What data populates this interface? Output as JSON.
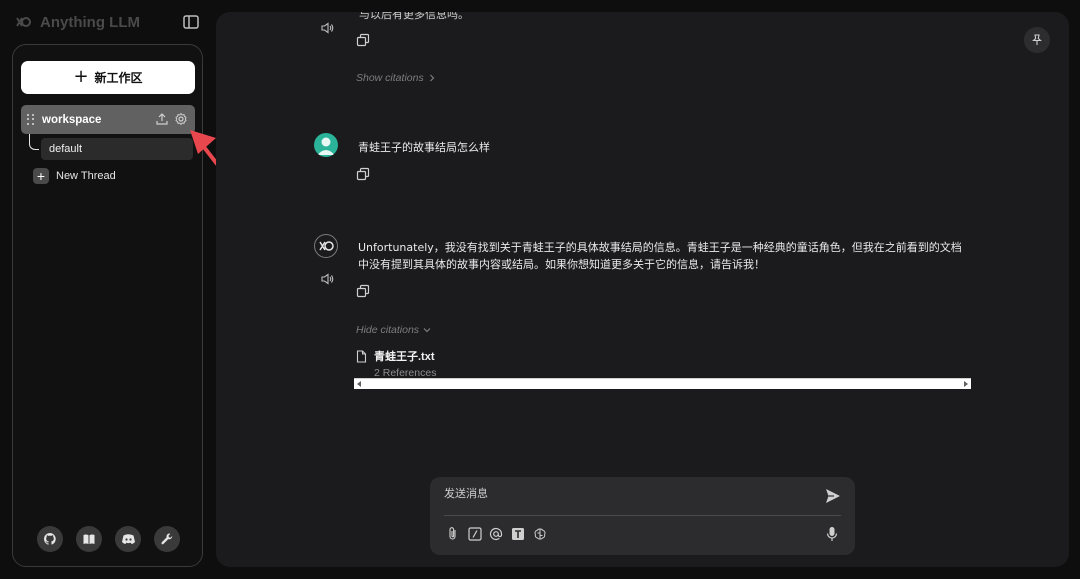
{
  "app": {
    "brand_name": "Anything LLM"
  },
  "sidebar": {
    "new_workspace_label": "新工作区",
    "workspace_name": "workspace",
    "thread_default": "default",
    "new_thread_label": "New Thread",
    "footer_icons": [
      "github-icon",
      "docs-book-icon",
      "discord-icon",
      "settings-wrench-icon"
    ]
  },
  "chat": {
    "top_partial_text": "与以后有更多信息吗。",
    "show_citations_label": "Show citations",
    "user_message": "青蛙王子的故事结局怎么样",
    "assistant_message": "Unfortunately，我没有找到关于青蛙王子的具体故事结局的信息。青蛙王子是一种经典的童话角色，但我在之前看到的文档中没有提到其具体的故事内容或结局。如果你想知道更多关于它的信息，请告诉我！",
    "hide_citations_label": "Hide citations",
    "citation": {
      "file_name": "青蛙王子.txt",
      "references": "2 References"
    }
  },
  "composer": {
    "placeholder": "发送消息",
    "tools": [
      "attachment-icon",
      "slash-command-icon",
      "mention-icon",
      "text-size-icon",
      "agent-brain-icon"
    ]
  },
  "colors": {
    "accent_arrow": "#e8474d",
    "user_avatar": "#2bb39a",
    "workspace_highlight": "#616161"
  }
}
